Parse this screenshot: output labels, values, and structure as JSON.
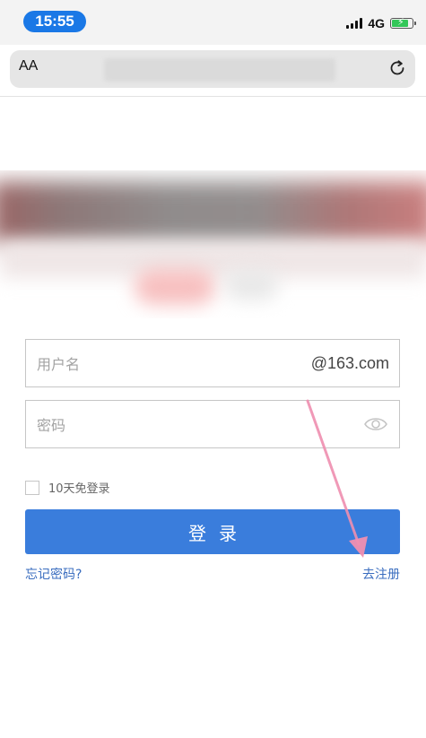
{
  "status_bar": {
    "time": "15:55",
    "network": "4G",
    "battery_icon": "battery-charging-icon",
    "signal_icon": "signal-icon"
  },
  "browser": {
    "text_size_label": "AA",
    "reload_icon": "reload-icon"
  },
  "login_form": {
    "username_placeholder": "用户名",
    "email_domain": "@163.com",
    "password_placeholder": "密码",
    "show_password_icon": "eye-icon",
    "remember_label": "10天免登录",
    "login_button_label": "登录",
    "forgot_password_label": "忘记密码?",
    "register_label": "去注册"
  },
  "colors": {
    "time_pill": "#1a78e6",
    "primary_button": "#3a7ddc",
    "link": "#3a6dbf",
    "annotation_arrow": "#ef8fb0"
  }
}
